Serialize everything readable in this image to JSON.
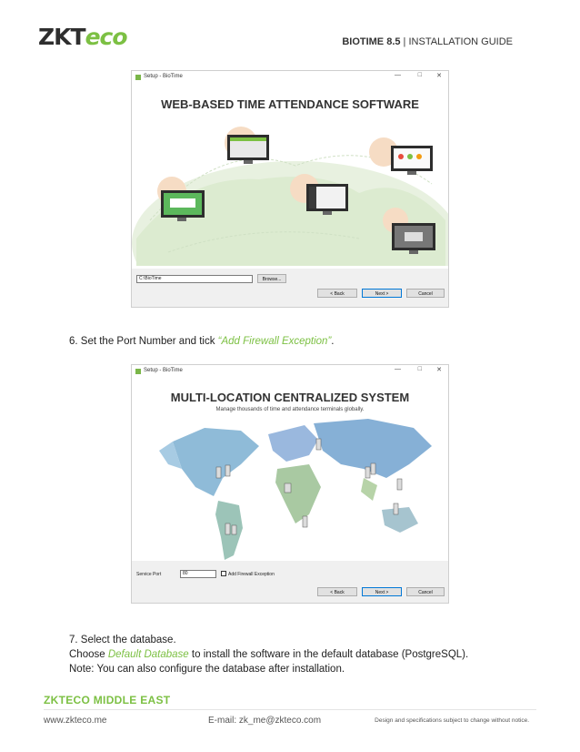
{
  "header": {
    "logo_main": "ZKT",
    "logo_accent": "eco",
    "product": "BIOTIME 8.5",
    "separator": " | ",
    "guide": "INSTALLATION GUIDE"
  },
  "window1": {
    "title": "Setup - BioTime",
    "heading": "WEB-BASED TIME ATTENDANCE SOFTWARE",
    "path_value": "C:\\BioTime",
    "browse_label": "Browse...",
    "back_label": "< Back",
    "next_label": "Next >",
    "cancel_label": "Cancel"
  },
  "step6": {
    "text_before": "6. Set the Port Number and tick ",
    "highlight": "“Add Firewall Exception”",
    "text_after": "."
  },
  "window2": {
    "title": "Setup - BioTime",
    "heading": "MULTI-LOCATION CENTRALIZED SYSTEM",
    "subheading": "Manage thousands of time and attendance terminals globally.",
    "port_label": "Service Port",
    "port_value": "80",
    "firewall_label": "Add Firewall Exception",
    "firewall_checked": false,
    "back_label": "< Back",
    "next_label": "Next >",
    "cancel_label": "Cancel"
  },
  "step7": {
    "line1": "7. Select the database.",
    "line2_before": "Choose ",
    "line2_highlight": "Default Database",
    "line2_after": " to install the software in the default database (PostgreSQL).",
    "line3": "Note: You can also configure the database after installation."
  },
  "footer": {
    "brand": "ZKTECO MIDDLE EAST",
    "website": "www.zkteco.me",
    "email": "E-mail: zk_me@zkteco.com",
    "disclaimer": "Design and specifications subject to change without notice."
  },
  "colors": {
    "accent": "#7cc043",
    "window_footer": "#f0f0f0",
    "primary_button_border": "#0078d7"
  }
}
